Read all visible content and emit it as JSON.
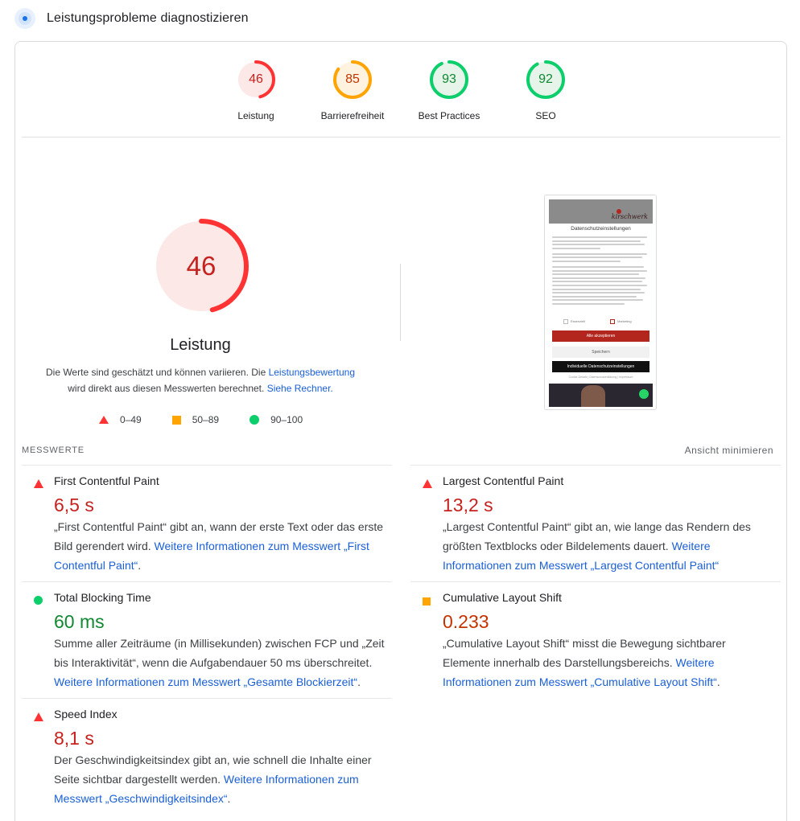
{
  "header": {
    "title": "Leistungsprobleme diagnostizieren",
    "icon": "diagnose-icon"
  },
  "gauges": [
    {
      "score": "46",
      "label": "Leistung",
      "value": 46,
      "color": "#ff3333",
      "bg": "#fce8e6"
    },
    {
      "score": "85",
      "label": "Barrierefreiheit",
      "value": 85,
      "color": "#ffa400",
      "bg": "#fff3e0"
    },
    {
      "score": "93",
      "label": "Best Practices",
      "value": 93,
      "color": "#0cce6b",
      "bg": "#e6f4ea"
    },
    {
      "score": "92",
      "label": "SEO",
      "value": 92,
      "color": "#0cce6b",
      "bg": "#e6f4ea"
    }
  ],
  "main_score": {
    "score": "46",
    "value": 46,
    "title": "Leistung",
    "color": "#ff3333",
    "bg": "#fce8e6"
  },
  "description": {
    "text1": "Die Werte sind geschätzt und können variieren. Die ",
    "link1": "Leistungsbewertung",
    "text2": " wird direkt aus diesen Messwerten berechnet. ",
    "link2": "Siehe Rechner."
  },
  "legend": {
    "red": "0–49",
    "orange": "50–89",
    "green": "90–100"
  },
  "screenshot": {
    "brand": "kirschwerk",
    "heading": "Datenschutzeinstellungen",
    "check1": "Essenziell",
    "check2": "Marketing",
    "btn_accept": "Alle akzeptieren",
    "btn_save": "Speichern",
    "btn_custom": "Individuelle Datenschutzeinstellungen",
    "footer": "Cookie-Details | Datenschutzerklärung | Impressum"
  },
  "metrics_section": {
    "heading": "MESSWERTE",
    "toggle": "Ansicht minimieren"
  },
  "metrics": {
    "fcp": {
      "name": "First Contentful Paint",
      "value": "6,5 s",
      "status": "red",
      "desc": "„First Contentful Paint“ gibt an, wann der erste Text oder das erste Bild gerendert wird. ",
      "link": "Weitere Informationen zum Messwert „First Contentful Paint“",
      "end": "."
    },
    "lcp": {
      "name": "Largest Contentful Paint",
      "value": "13,2 s",
      "status": "red",
      "desc": "„Largest Contentful Paint“ gibt an, wie lange das Rendern des größten Textblocks oder Bildelements dauert. ",
      "link": "Weitere Informationen zum Messwert „Largest Contentful Paint“",
      "end": ""
    },
    "tbt": {
      "name": "Total Blocking Time",
      "value": "60 ms",
      "status": "green",
      "desc": "Summe aller Zeiträume (in Millisekunden) zwischen FCP und „Zeit bis Interaktivität“, wenn die Aufgabendauer 50 ms überschreitet. ",
      "link": "Weitere Informationen zum Messwert „Gesamte Blockierzeit“",
      "end": "."
    },
    "cls": {
      "name": "Cumulative Layout Shift",
      "value": "0.233",
      "status": "orange",
      "desc": "„Cumulative Layout Shift“ misst die Bewegung sichtbarer Elemente innerhalb des Darstellungsbereichs. ",
      "link": "Weitere Informationen zum Messwert „Cumulative Layout Shift“",
      "end": "."
    },
    "si": {
      "name": "Speed Index",
      "value": "8,1 s",
      "status": "red",
      "desc": "Der Geschwindigkeitsindex gibt an, wie schnell die Inhalte einer Seite sichtbar dargestellt werden. ",
      "link": "Weitere Informationen zum Messwert „Geschwindigkeitsindex“",
      "end": "."
    }
  }
}
